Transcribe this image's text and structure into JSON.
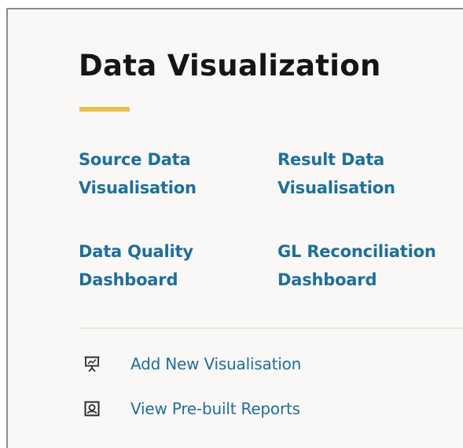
{
  "section": {
    "title": "Data Visualization"
  },
  "links": {
    "source_data": [
      "Source Data",
      "Visualisation"
    ],
    "result_data": [
      "Result Data",
      "Visualisation"
    ],
    "data_quality": [
      "Data Quality",
      "Dashboard"
    ],
    "gl_reconciliation": [
      "GL Reconciliation",
      "Dashboard"
    ]
  },
  "actions": {
    "add_new": {
      "label": "Add New Visualisation",
      "icon": "presentation-board-icon"
    },
    "view_reports": {
      "label": "View Pre-built Reports",
      "icon": "report-icon"
    }
  },
  "colors": {
    "accent": "#e8c04f",
    "link": "#1e6f9a",
    "title": "#161513",
    "background": "#f9f8f6"
  }
}
